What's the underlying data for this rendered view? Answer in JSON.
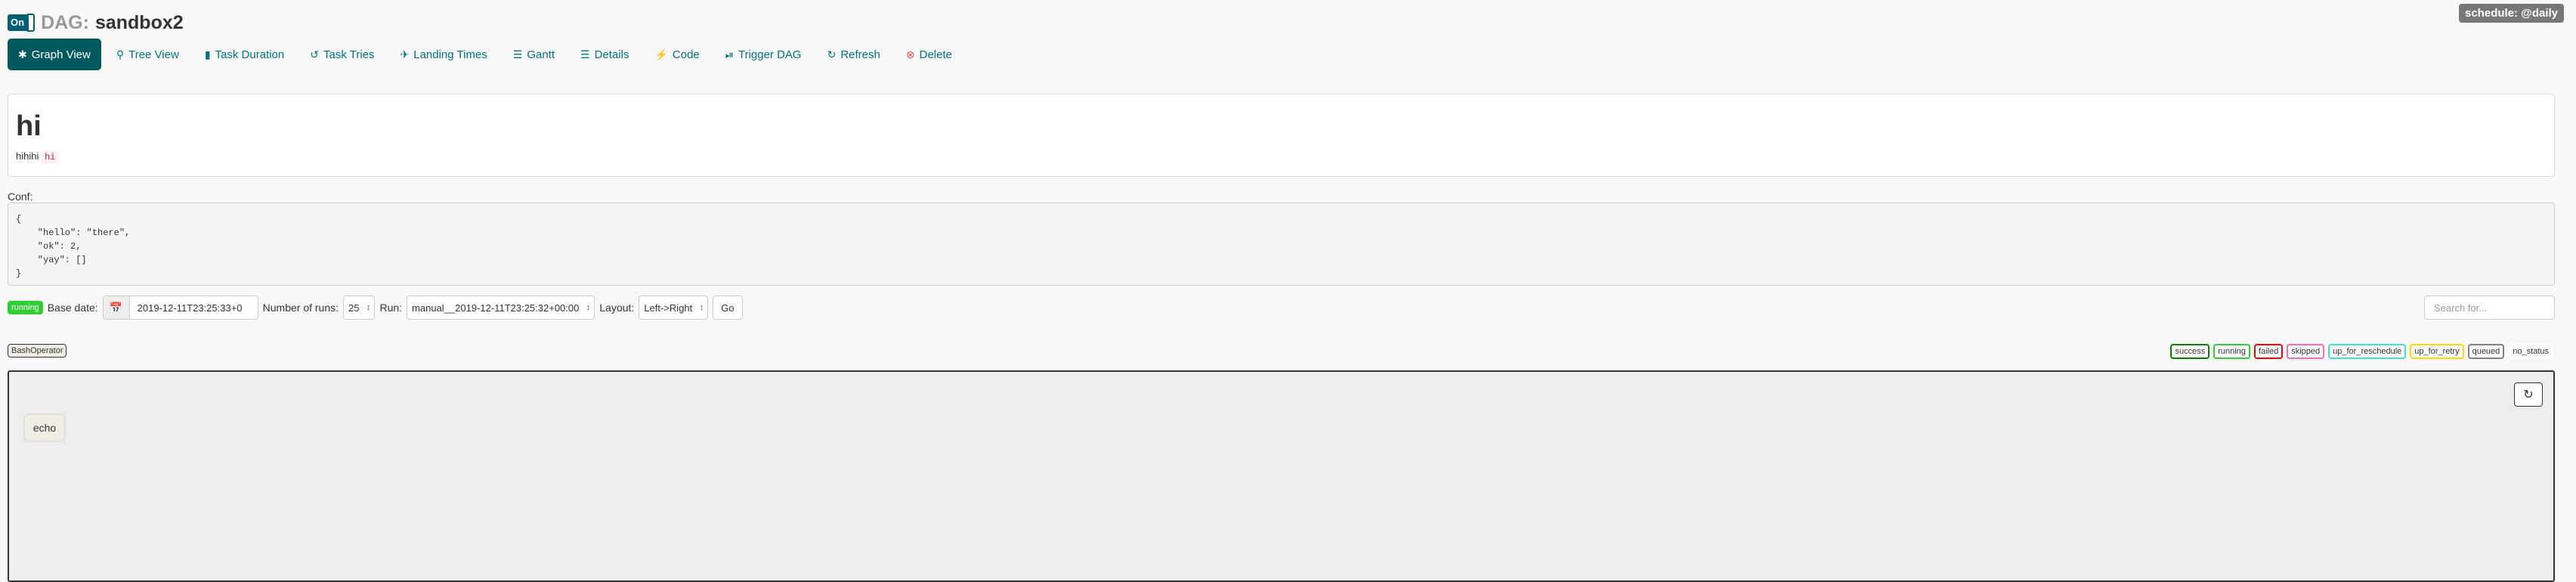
{
  "header": {
    "toggle_label": "On",
    "dag_label": "DAG:",
    "dag_name": "sandbox2",
    "schedule": "schedule: @daily"
  },
  "nav": [
    {
      "label": "Graph View",
      "icon": "graph-icon",
      "active": true
    },
    {
      "label": "Tree View",
      "icon": "tree-icon"
    },
    {
      "label": "Task Duration",
      "icon": "bar-chart-icon"
    },
    {
      "label": "Task Tries",
      "icon": "retry-icon"
    },
    {
      "label": "Landing Times",
      "icon": "plane-icon"
    },
    {
      "label": "Gantt",
      "icon": "gantt-icon"
    },
    {
      "label": "Details",
      "icon": "list-icon"
    },
    {
      "label": "Code",
      "icon": "flash-icon"
    },
    {
      "label": "Trigger DAG",
      "icon": "play-circle-icon"
    },
    {
      "label": "Refresh",
      "icon": "refresh-icon"
    },
    {
      "label": "Delete",
      "icon": "remove-circle-icon"
    }
  ],
  "description": {
    "title": "hi",
    "text": "hihihi",
    "code": "hi"
  },
  "conf": {
    "label": "Conf:",
    "body": "{\n    \"hello\": \"there\",\n    \"ok\": 2,\n    \"yay\": []\n}"
  },
  "controls": {
    "state": "running",
    "base_date_label": "Base date:",
    "base_date": "2019-12-11T23:25:33+0",
    "runs_label": "Number of runs:",
    "runs": "25",
    "run_label": "Run:",
    "run": "manual__2019-12-11T23:25:32+00:00",
    "layout_label": "Layout:",
    "layout": "Left->Right",
    "go": "Go",
    "search_placeholder": "Search for..."
  },
  "legend": {
    "operator": "BashOperator",
    "statuses": [
      {
        "label": "success",
        "color": "#008000"
      },
      {
        "label": "running",
        "color": "#32cd32"
      },
      {
        "label": "failed",
        "color": "#ff0000"
      },
      {
        "label": "skipped",
        "color": "#ff69b4"
      },
      {
        "label": "up_for_reschedule",
        "color": "#40e0d0"
      },
      {
        "label": "up_for_retry",
        "color": "#ffd700"
      },
      {
        "label": "queued",
        "color": "#808080"
      },
      {
        "label": "no_status",
        "color": "#ffffff"
      }
    ]
  },
  "graph": {
    "nodes": [
      "echo"
    ]
  },
  "colors": {
    "accent": "#00595f",
    "link": "#00727f",
    "node_fill": "#f0ede4"
  }
}
